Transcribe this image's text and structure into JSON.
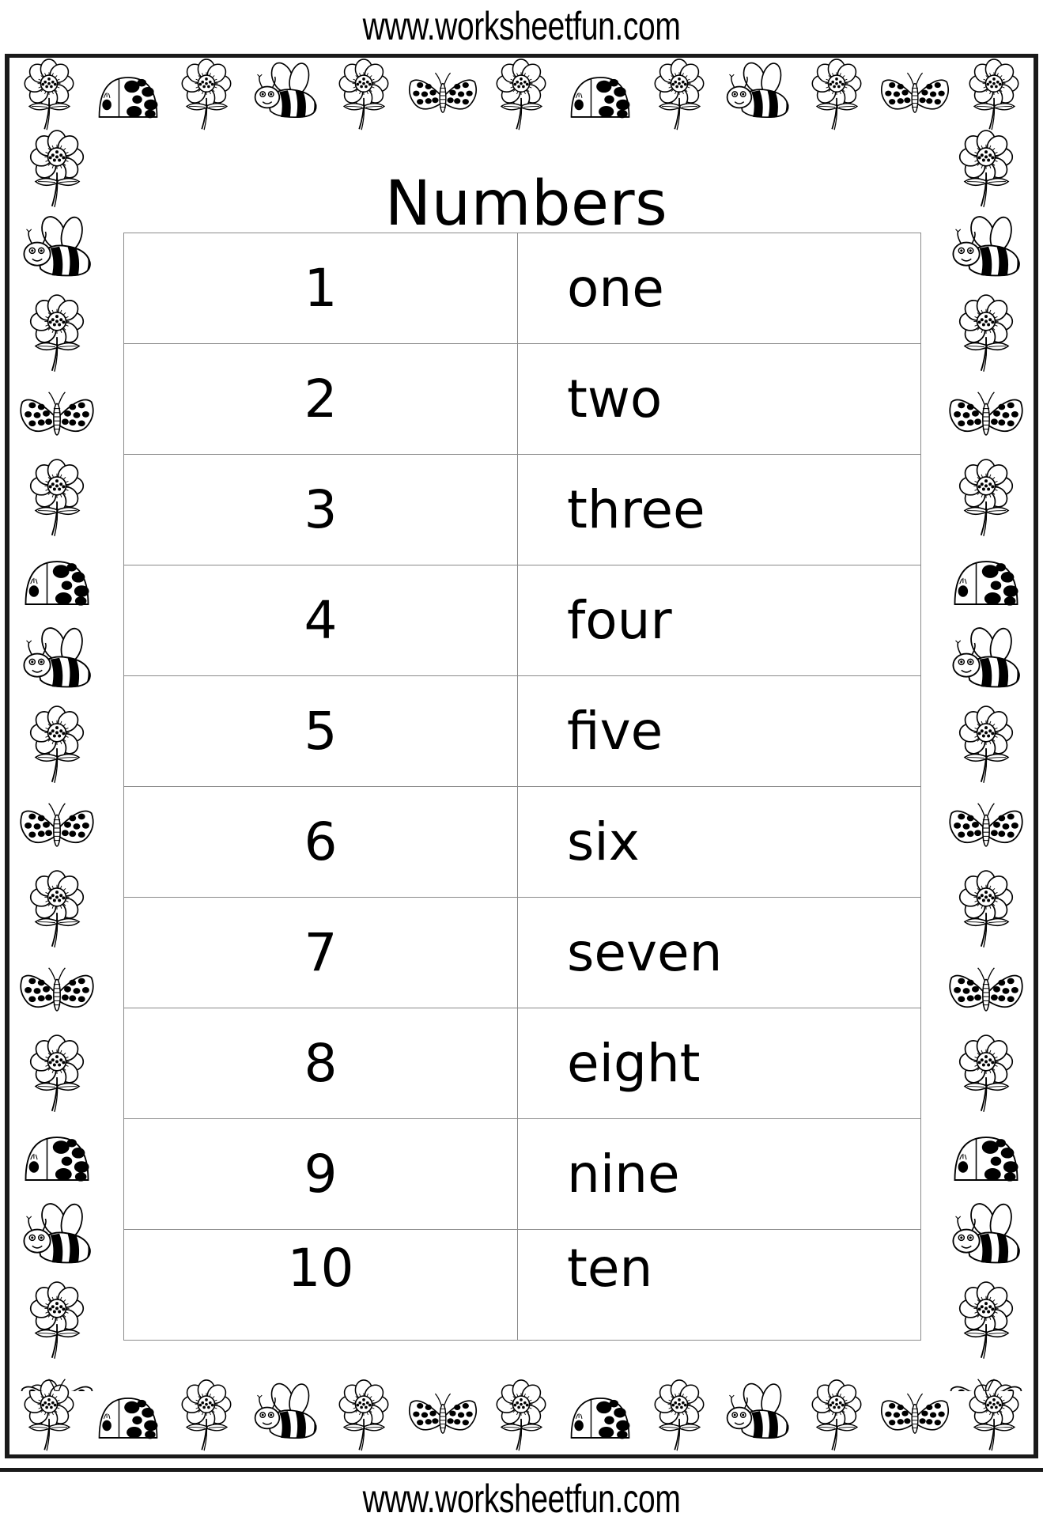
{
  "watermark": {
    "top": "www.worksheetfun.com",
    "bottom": "www.worksheetfun.com"
  },
  "worksheet": {
    "title": "Numbers",
    "columns": [
      "digit",
      "word"
    ],
    "rows": [
      {
        "digit": "1",
        "word": "one"
      },
      {
        "digit": "2",
        "word": "two"
      },
      {
        "digit": "3",
        "word": "three"
      },
      {
        "digit": "4",
        "word": "four"
      },
      {
        "digit": "5",
        "word": "five"
      },
      {
        "digit": "6",
        "word": "six"
      },
      {
        "digit": "7",
        "word": "seven"
      },
      {
        "digit": "8",
        "word": "eight"
      },
      {
        "digit": "9",
        "word": "nine"
      },
      {
        "digit": "10",
        "word": "ten"
      }
    ]
  },
  "decorations": {
    "top": [
      "flower",
      "ladybug",
      "flower",
      "bee",
      "flower",
      "butterfly",
      "flower",
      "ladybug",
      "flower",
      "bee",
      "flower",
      "butterfly",
      "flower"
    ],
    "bottom": [
      "flower",
      "ladybug",
      "flower",
      "bee",
      "flower",
      "butterfly",
      "flower",
      "ladybug",
      "flower",
      "bee",
      "flower",
      "butterfly",
      "flower"
    ],
    "left": [
      "flower",
      "bee",
      "flower",
      "butterfly",
      "flower",
      "ladybug",
      "bee",
      "flower",
      "butterfly",
      "flower",
      "butterfly",
      "flower",
      "ladybug",
      "bee",
      "flower",
      "butterfly"
    ],
    "right": [
      "flower",
      "bee",
      "flower",
      "butterfly",
      "flower",
      "ladybug",
      "bee",
      "flower",
      "butterfly",
      "flower",
      "butterfly",
      "flower",
      "ladybug",
      "bee",
      "flower",
      "butterfly"
    ]
  },
  "colors": {
    "ink": "#000000",
    "frame": "#1a1a1a",
    "grid": "#8a8a8a",
    "paper": "#ffffff"
  }
}
